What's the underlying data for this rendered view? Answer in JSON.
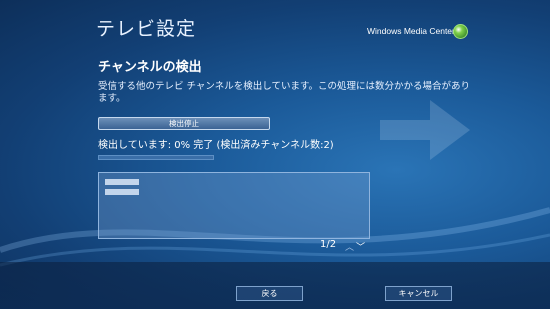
{
  "header": {
    "title": "テレビ設定",
    "brand": "Windows Media Center"
  },
  "main": {
    "section_title": "チャンネルの検出",
    "description": "受信する他のテレビ チャンネルを検出しています。この処理には数分かかる場合があります。",
    "stop_button_label": "検出停止",
    "status_text": "検出しています: 0% 完了 (検出済みチャンネル数:2)",
    "progress_percent": 0,
    "results": [
      {
        "label": ""
      },
      {
        "label": ""
      }
    ],
    "pager": {
      "text": "1/2",
      "up_icon": "chevron-up-icon",
      "down_icon": "chevron-down-icon"
    }
  },
  "footer": {
    "back_label": "戻る",
    "cancel_label": "キャンセル"
  },
  "colors": {
    "background": "#1b5a99",
    "accent": "#bcd8ff"
  }
}
